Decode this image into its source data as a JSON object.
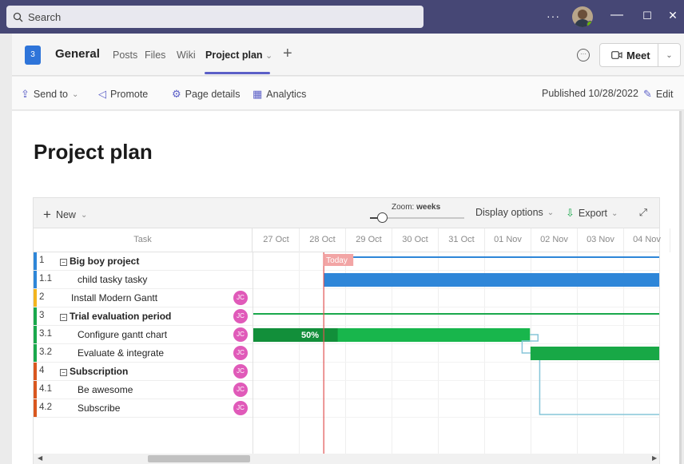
{
  "titlebar": {
    "search_placeholder": "Search",
    "more_label": "···",
    "minimize": "—",
    "maximize": "☐",
    "close": "✕"
  },
  "channel": {
    "team_badge": "3",
    "name": "General",
    "tabs": [
      {
        "label": "Posts"
      },
      {
        "label": "Files"
      },
      {
        "label": "Wiki"
      },
      {
        "label": "Project plan"
      }
    ],
    "active_tab_chevron": "⌄",
    "add_tab": "+",
    "meet_label": "Meet"
  },
  "page_toolbar": {
    "send_to": "Send to",
    "promote": "Promote",
    "page_details": "Page details",
    "analytics": "Analytics",
    "published": "Published 10/28/2022",
    "edit": "Edit"
  },
  "page": {
    "title": "Project plan"
  },
  "gantt": {
    "new_label": "New",
    "zoom_prefix": "Zoom: ",
    "zoom_value": "weeks",
    "zoom_level": 0.13,
    "display_options": "Display options",
    "export": "Export",
    "task_header": "Task",
    "days": [
      "27 Oct",
      "28 Oct",
      "29 Oct",
      "30 Oct",
      "31 Oct",
      "01 Nov",
      "02 Nov",
      "03 Nov",
      "04 Nov"
    ],
    "today_label": "Today",
    "today_color": "#e05252",
    "tasks": [
      {
        "num": "1",
        "name": "Big boy project",
        "parent": true,
        "color": "#2e86d8",
        "assignee": "",
        "collapse": "−"
      },
      {
        "num": "1.1",
        "name": "child tasky tasky",
        "parent": false,
        "color": "#2e86d8",
        "assignee": ""
      },
      {
        "num": "2",
        "name": "Install Modern Gantt",
        "parent": false,
        "color": "#f2b41e",
        "assignee": "JC"
      },
      {
        "num": "3",
        "name": "Trial evaluation period",
        "parent": true,
        "color": "#1aa84c",
        "assignee": "JC",
        "collapse": "−"
      },
      {
        "num": "3.1",
        "name": "Configure gantt chart",
        "parent": false,
        "color": "#1aa84c",
        "assignee": "JC"
      },
      {
        "num": "3.2",
        "name": "Evaluate & integrate",
        "parent": false,
        "color": "#1aa84c",
        "assignee": "JC"
      },
      {
        "num": "4",
        "name": "Subscription",
        "parent": true,
        "color": "#d9571f",
        "assignee": "JC",
        "collapse": "−"
      },
      {
        "num": "4.1",
        "name": "Be awesome",
        "parent": false,
        "color": "#d9571f",
        "assignee": "JC"
      },
      {
        "num": "4.2",
        "name": "Subscribe",
        "parent": false,
        "color": "#d9571f",
        "assignee": "JC"
      }
    ],
    "progress_label": "50%",
    "progress_value": 0.5
  }
}
